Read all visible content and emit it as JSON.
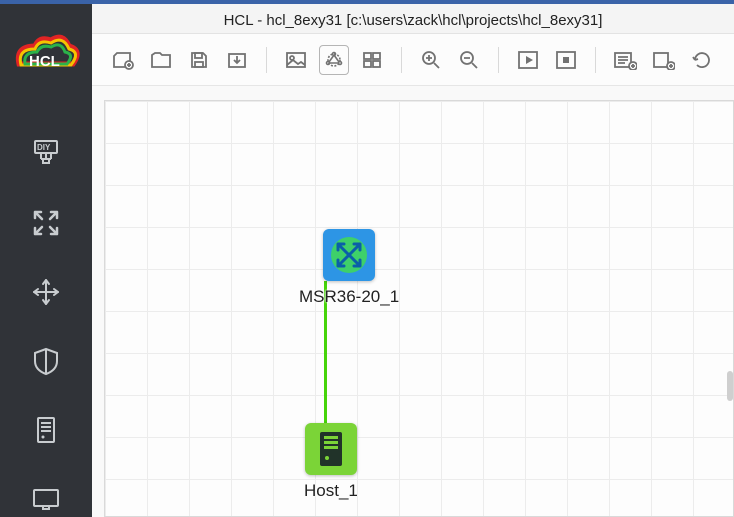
{
  "title": {
    "app": "HCL",
    "project": "hcl_8exy31",
    "path": "c:\\users\\zack\\hcl\\projects\\hcl_8exy31"
  },
  "sidebar": {
    "items": [
      {
        "name": "diy"
      },
      {
        "name": "expand"
      },
      {
        "name": "move"
      },
      {
        "name": "shield"
      },
      {
        "name": "server"
      },
      {
        "name": "monitor"
      }
    ]
  },
  "toolbar": {
    "groups": [
      [
        "new-file",
        "open-file",
        "save",
        "export"
      ],
      [
        "image",
        "graph",
        "grid"
      ],
      [
        "zoom-in",
        "zoom-out"
      ],
      [
        "play",
        "stop"
      ],
      [
        "add-list",
        "add-node",
        "reload"
      ]
    ]
  },
  "nodes": {
    "router": {
      "label": "MSR36-20_1"
    },
    "host": {
      "label": "Host_1"
    }
  }
}
